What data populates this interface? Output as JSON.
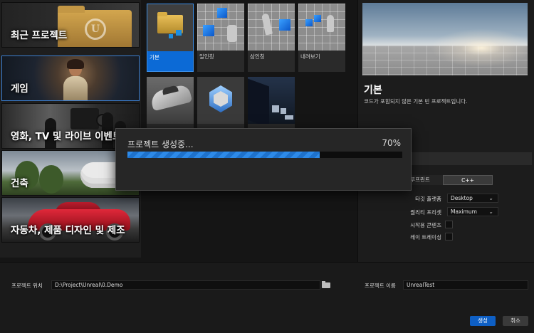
{
  "categories": [
    {
      "label": "최근 프로젝트",
      "selected": false
    },
    {
      "label": "게임",
      "selected": true
    },
    {
      "label": "영화, TV 및 라이브 이벤트",
      "selected": false
    },
    {
      "label": "건축",
      "selected": false
    },
    {
      "label": "자동차, 제품 디자인 및 제조",
      "selected": false
    }
  ],
  "templates": [
    {
      "label": "기본",
      "icon": "blank-folder-icon",
      "selected": true
    },
    {
      "label": "일인칭",
      "icon": "first-person-icon",
      "selected": false
    },
    {
      "label": "삼인칭",
      "icon": "third-person-icon",
      "selected": false
    },
    {
      "label": "내려보기",
      "icon": "top-down-icon",
      "selected": false
    },
    {
      "label": "",
      "icon": "vehicle-icon",
      "selected": false
    },
    {
      "label": "",
      "icon": "handheld-ar-icon",
      "selected": false
    },
    {
      "label": "",
      "icon": "virtual-reality-icon",
      "selected": false
    }
  ],
  "detail": {
    "title": "기본",
    "description": "코드가 포함되지 않은 기본 빈 프로젝트입니다."
  },
  "project_defaults": {
    "blueprint_label": "블루프린트",
    "blueprint_visible_label": "루프린트",
    "cpp_label": "C++",
    "selected": "C++",
    "target_platform": {
      "label": "타깃 플랫폼",
      "value": "Desktop"
    },
    "quality_preset": {
      "label": "퀄리티 프리셋",
      "value": "Maximum"
    },
    "starter_content": {
      "label": "시작용 콘텐츠",
      "checked": false
    },
    "raytracing": {
      "label": "레이 트레이싱",
      "checked": false
    }
  },
  "bottom": {
    "location_label": "프로젝트 위치",
    "location_value": "D:\\Project\\Unreal\\0.Demo",
    "name_label": "프로젝트 이름",
    "name_value": "UnrealTest",
    "create_label": "생성",
    "cancel_label": "취소"
  },
  "progress_modal": {
    "title": "프로젝트 생성중...",
    "percent_text": "70%",
    "percent": 70
  },
  "colors": {
    "accent": "#0c6ad6",
    "progress": "#2d8ae8",
    "background": "#151515"
  }
}
